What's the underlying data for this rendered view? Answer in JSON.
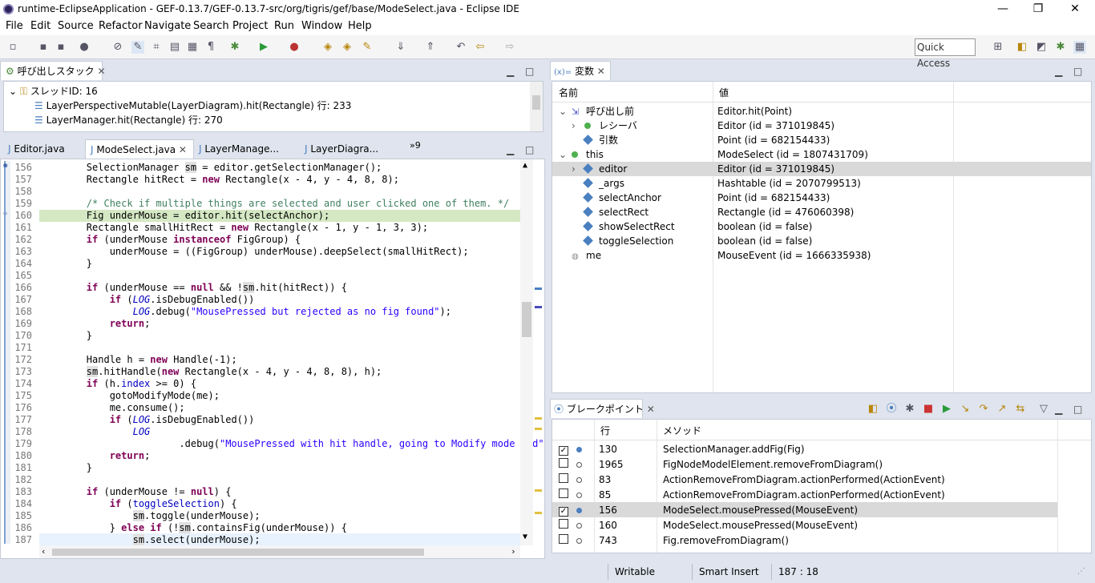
{
  "window": {
    "title": "runtime-EclipseApplication - GEF-0.13.7/GEF-0.13.7-src/org/tigris/gef/base/ModeSelect.java - Eclipse IDE",
    "minimize": "—",
    "restore": "❐",
    "close": "✕"
  },
  "menu": [
    "File",
    "Edit",
    "Source",
    "Refactor",
    "Navigate",
    "Search",
    "Project",
    "Run",
    "Window",
    "Help"
  ],
  "toolbar": {
    "quick_access_label": "Quick Access"
  },
  "callstack": {
    "tab_label": "呼び出しスタック",
    "thread": "スレッドID: 16",
    "frames": [
      "LayerPerspectiveMutable(LayerDiagram).hit(Rectangle) 行: 233",
      "LayerManager.hit(Rectangle) 行: 270"
    ]
  },
  "editor": {
    "tabs": [
      "Editor.java",
      "ModeSelect.java",
      "LayerManage...",
      "LayerDiagra..."
    ],
    "overflow_label": "»9",
    "lines": [
      {
        "n": "156",
        "html": "        SelectionManager <span class='hlv'>sm</span> = editor.getSelectionManager();"
      },
      {
        "n": "157",
        "html": "        Rectangle hitRect = <span class='kw'>new</span> Rectangle(x - 4, y - 4, 8, 8);"
      },
      {
        "n": "158",
        "html": ""
      },
      {
        "n": "159",
        "html": "        <span class='cm'>/* Check if multiple things are selected and user clicked one of them. */</span>"
      },
      {
        "n": "160",
        "html": "        Fig underMouse = editor.hit(selectAnchor);"
      },
      {
        "n": "161",
        "html": "        Rectangle smallHitRect = <span class='kw'>new</span> Rectangle(x - 1, y - 1, 3, 3);"
      },
      {
        "n": "162",
        "html": "        <span class='kw'>if</span> (underMouse <span class='kw'>instanceof</span> FigGroup) {"
      },
      {
        "n": "163",
        "html": "            underMouse = ((FigGroup) underMouse).deepSelect(smallHitRect);"
      },
      {
        "n": "164",
        "html": "        }"
      },
      {
        "n": "165",
        "html": ""
      },
      {
        "n": "166",
        "html": "        <span class='kw'>if</span> (underMouse == <span class='kw'>null</span> &amp;&amp; !<span class='hlv'>sm</span>.hit(hitRect)) {"
      },
      {
        "n": "167",
        "html": "            <span class='kw'>if</span> (<span class='fld'>LOG</span>.isDebugEnabled())"
      },
      {
        "n": "168",
        "html": "                <span class='fld'>LOG</span>.debug(<span class='st'>\"MousePressed but rejected as no fig found\"</span>);"
      },
      {
        "n": "169",
        "html": "            <span class='kw'>return</span>;"
      },
      {
        "n": "170",
        "html": "        }"
      },
      {
        "n": "171",
        "html": ""
      },
      {
        "n": "172",
        "html": "        Handle h = <span class='kw'>new</span> Handle(-1);"
      },
      {
        "n": "173",
        "html": "        <span class='hlv'>sm</span>.hitHandle(<span class='kw'>new</span> Rectangle(x - 4, y - 4, 8, 8), h);"
      },
      {
        "n": "174",
        "html": "        <span class='kw'>if</span> (h.<span class='fld' style='font-style:normal'>index</span> &gt;= 0) {"
      },
      {
        "n": "175",
        "html": "            gotoModifyMode(me);"
      },
      {
        "n": "176",
        "html": "            me.consume();"
      },
      {
        "n": "177",
        "html": "            <span class='kw'>if</span> (<span class='fld'>LOG</span>.isDebugEnabled())"
      },
      {
        "n": "178",
        "html": "                <span class='fld'>LOG</span>"
      },
      {
        "n": "179",
        "html": "                        .debug(<span class='st'>\"MousePressed with hit handle, going to Modify mode and\"</span>"
      },
      {
        "n": "180",
        "html": "            <span class='kw'>return</span>;"
      },
      {
        "n": "181",
        "html": "        }"
      },
      {
        "n": "182",
        "html": ""
      },
      {
        "n": "183",
        "html": "        <span class='kw'>if</span> (underMouse != <span class='kw'>null</span>) {"
      },
      {
        "n": "184",
        "html": "            <span class='kw'>if</span> (<span class='fld' style='font-style:normal'>toggleSelection</span>) {"
      },
      {
        "n": "185",
        "html": "                <span class='hlv'>sm</span>.toggle(underMouse);"
      },
      {
        "n": "186",
        "html": "            } <span class='kw'>else if</span> (!<span class='hlv'>sm</span>.containsFig(underMouse)) {"
      },
      {
        "n": "187",
        "html": "                <span class='hlv'>sm</span>.select(underMouse);"
      }
    ]
  },
  "variables": {
    "tab_label": "変数",
    "tab_prefix": "(x)=",
    "col_name": "名前",
    "col_value": "値",
    "rows": [
      {
        "indent": 0,
        "twisty": "v",
        "icon": "return",
        "name": "呼び出し前",
        "value": "Editor.hit(Point)"
      },
      {
        "indent": 1,
        "twisty": ">",
        "icon": "dot",
        "name": "レシーバ",
        "value": "Editor (id = 371019845)"
      },
      {
        "indent": 1,
        "twisty": "",
        "icon": "diamond",
        "name": "引数",
        "value": "Point (id = 682154433)"
      },
      {
        "indent": 0,
        "twisty": "v",
        "icon": "dot",
        "name": "this",
        "value": "ModeSelect (id = 1807431709)"
      },
      {
        "indent": 1,
        "twisty": ">",
        "icon": "diamond",
        "name": "editor",
        "value": "Editor (id = 371019845)"
      },
      {
        "indent": 1,
        "twisty": "",
        "icon": "diamond",
        "name": "_args",
        "value": "Hashtable (id = 2070799513)"
      },
      {
        "indent": 1,
        "twisty": "",
        "icon": "diamond",
        "name": "selectAnchor",
        "value": "Point (id = 682154433)"
      },
      {
        "indent": 1,
        "twisty": "",
        "icon": "diamond",
        "name": "selectRect",
        "value": "Rectangle (id = 476060398)"
      },
      {
        "indent": 1,
        "twisty": "",
        "icon": "diamond",
        "name": "showSelectRect",
        "value": "boolean (id = false)"
      },
      {
        "indent": 1,
        "twisty": "",
        "icon": "diamond",
        "name": "toggleSelection",
        "value": "boolean (id = false)"
      },
      {
        "indent": 0,
        "twisty": "",
        "icon": "local",
        "name": "me",
        "value": "MouseEvent (id = 1666335938)"
      }
    ]
  },
  "breakpoints": {
    "tab_label": "ブレークポイント",
    "col_line": "行",
    "col_method": "メソッド",
    "rows": [
      {
        "checked": true,
        "line": "130",
        "method": "SelectionManager.addFig(Fig)"
      },
      {
        "checked": false,
        "line": "1965",
        "method": "FigNodeModelElement.removeFromDiagram()"
      },
      {
        "checked": false,
        "line": "83",
        "method": "ActionRemoveFromDiagram.actionPerformed(ActionEvent)"
      },
      {
        "checked": false,
        "line": "85",
        "method": "ActionRemoveFromDiagram.actionPerformed(ActionEvent)"
      },
      {
        "checked": true,
        "line": "156",
        "method": "ModeSelect.mousePressed(MouseEvent)"
      },
      {
        "checked": false,
        "line": "160",
        "method": "ModeSelect.mousePressed(MouseEvent)"
      },
      {
        "checked": false,
        "line": "743",
        "method": "Fig.removeFromDiagram()"
      }
    ]
  },
  "status": {
    "writable": "Writable",
    "insert_mode": "Smart Insert",
    "position": "187 : 18"
  }
}
